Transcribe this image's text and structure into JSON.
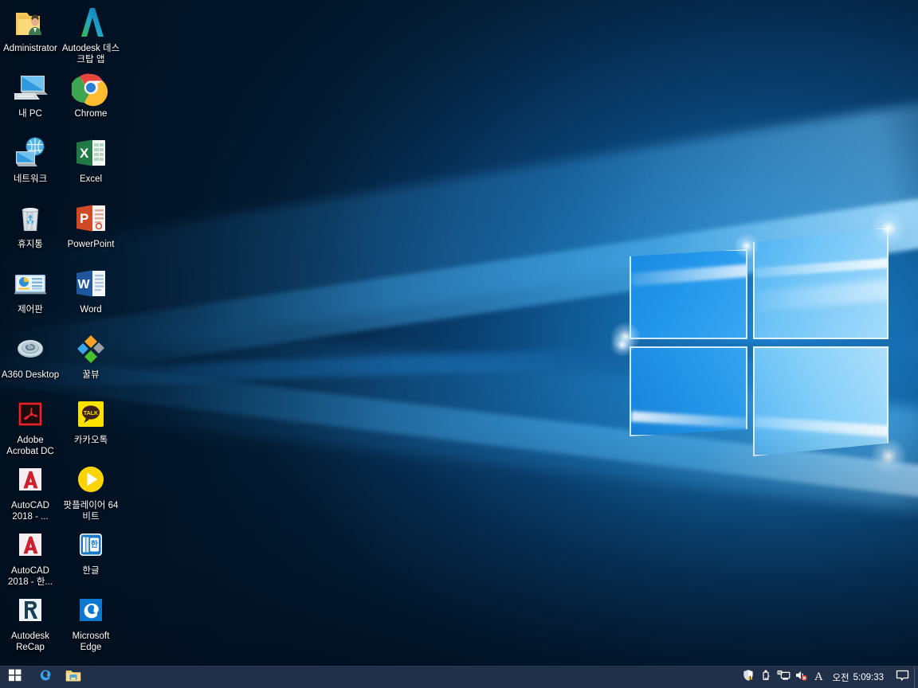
{
  "os": {
    "name": "Windows 10",
    "theme_accent": "#0078d7",
    "wallpaper": "windows-10-hero-light-blue",
    "taskbar_color": "#1f3048",
    "desktop_background_color": "#04203d"
  },
  "desktop": {
    "icons": [
      {
        "label": "Administrator",
        "icon": "user-folder-icon",
        "col": 0,
        "row": 0
      },
      {
        "label": "Autodesk 데스크탑 앱",
        "icon": "autodesk-desktop-app-icon",
        "col": 1,
        "row": 0
      },
      {
        "label": "내 PC",
        "icon": "this-pc-icon",
        "col": 0,
        "row": 1
      },
      {
        "label": "Chrome",
        "icon": "chrome-icon",
        "col": 1,
        "row": 1
      },
      {
        "label": "네트워크",
        "icon": "network-icon",
        "col": 0,
        "row": 2
      },
      {
        "label": "Excel",
        "icon": "excel-icon",
        "col": 1,
        "row": 2
      },
      {
        "label": "휴지통",
        "icon": "recycle-bin-icon",
        "col": 0,
        "row": 3
      },
      {
        "label": "PowerPoint",
        "icon": "powerpoint-icon",
        "col": 1,
        "row": 3
      },
      {
        "label": "제어판",
        "icon": "control-panel-icon",
        "col": 0,
        "row": 4
      },
      {
        "label": "Word",
        "icon": "word-icon",
        "col": 1,
        "row": 4
      },
      {
        "label": "A360 Desktop",
        "icon": "a360-desktop-icon",
        "col": 0,
        "row": 5
      },
      {
        "label": "꿀뷰",
        "icon": "honeyview-icon",
        "col": 1,
        "row": 5
      },
      {
        "label": "Adobe Acrobat DC",
        "icon": "adobe-acrobat-icon",
        "col": 0,
        "row": 6
      },
      {
        "label": "카카오톡",
        "icon": "kakaotalk-icon",
        "col": 1,
        "row": 6
      },
      {
        "label": "AutoCAD 2018 - ...",
        "icon": "autocad-icon",
        "col": 0,
        "row": 7
      },
      {
        "label": "팟플레이어 64 비트",
        "icon": "potplayer-icon",
        "col": 1,
        "row": 7
      },
      {
        "label": "AutoCAD 2018 - 한...",
        "icon": "autocad-icon",
        "col": 0,
        "row": 8
      },
      {
        "label": "한글",
        "icon": "hangul-hwp-icon",
        "col": 1,
        "row": 8
      },
      {
        "label": "Autodesk ReCap",
        "icon": "autodesk-recap-icon",
        "col": 0,
        "row": 9
      },
      {
        "label": "Microsoft Edge",
        "icon": "microsoft-edge-icon",
        "col": 1,
        "row": 9
      }
    ]
  },
  "taskbar": {
    "start_label": "시작",
    "start_icon": "windows-start-icon",
    "pinned": [
      {
        "label": "Microsoft Edge",
        "icon": "microsoft-edge-taskbar-icon"
      },
      {
        "label": "파일 탐색기",
        "icon": "file-explorer-icon"
      }
    ],
    "tray": [
      {
        "label": "보안 경고",
        "icon": "security-shield-warning-icon"
      },
      {
        "label": "하드웨어 안전하게 제거",
        "icon": "usb-eject-icon"
      },
      {
        "label": "네트워크 연결",
        "icon": "network-monitor-icon"
      },
      {
        "label": "소리 음소거됨",
        "icon": "speaker-muted-icon"
      },
      {
        "label": "한국어 입력기",
        "icon": "ime-alpha-icon",
        "text": "A"
      }
    ],
    "clock": {
      "ampm": "오전",
      "time": "5:09:33"
    },
    "action_center": {
      "label": "알림 센터",
      "icon": "notification-center-icon"
    },
    "show_desktop": {
      "label": "바탕 화면 보기",
      "icon": "show-desktop-strip"
    }
  }
}
